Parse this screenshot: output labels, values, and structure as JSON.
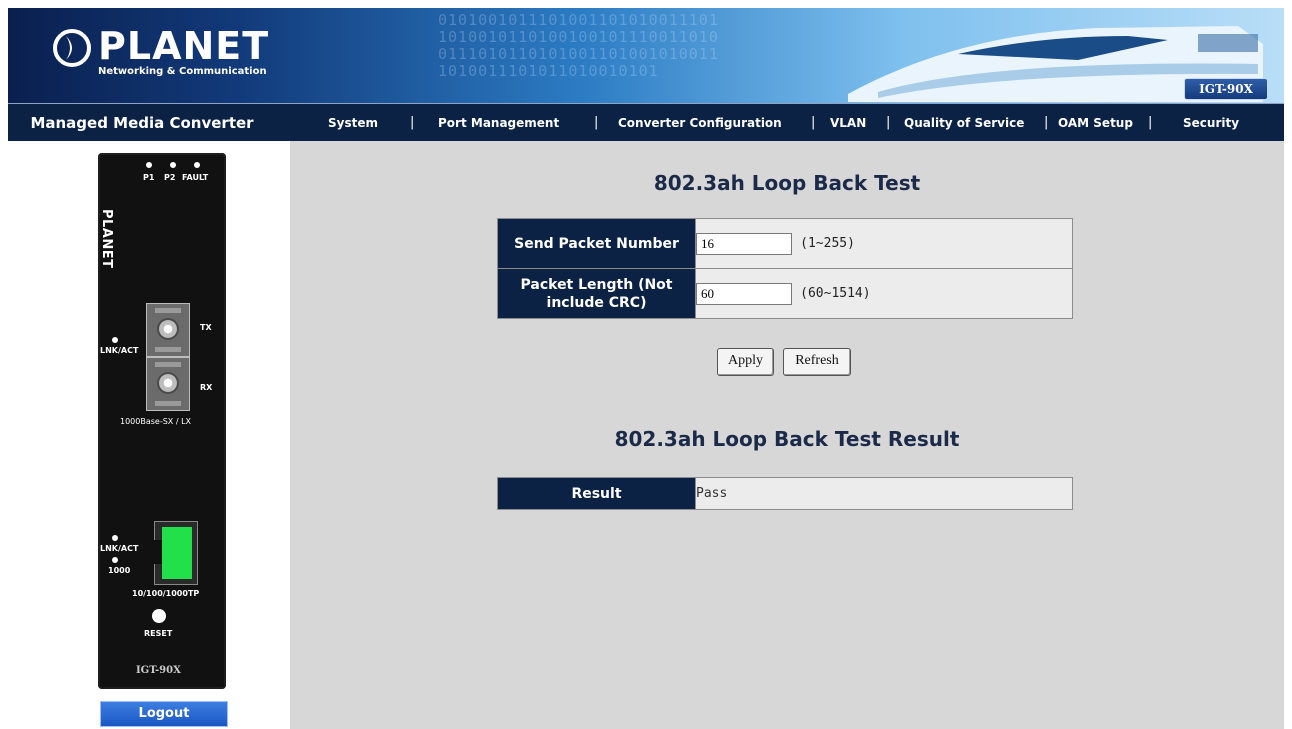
{
  "banner": {
    "brand": "PLANET",
    "tagline": "Networking & Communication",
    "model_badge": "IGT-90X"
  },
  "navbar": {
    "product_name": "Managed Media Converter",
    "items": [
      "System",
      "Port Management",
      "Converter Configuration",
      "VLAN",
      "Quality of Service",
      "OAM Setup",
      "Security"
    ]
  },
  "device": {
    "brand": "PLANET",
    "led_labels": [
      "P1",
      "P2",
      "FAULT"
    ],
    "fiber_link_label": "LNK/ACT",
    "tx_label": "TX",
    "rx_label": "RX",
    "fiber_port_label": "1000Base-SX / LX",
    "tp_link_label": "LNK/ACT",
    "tp_speed_label": "1000",
    "tp_port_label": "10/100/1000TP",
    "reset_label": "RESET",
    "model": "IGT-90X"
  },
  "logout_label": "Logout",
  "loopback_test": {
    "title": "802.3ah Loop Back Test",
    "send_packet_label": "Send Packet Number",
    "send_packet_value": "16",
    "send_packet_range": "(1~255)",
    "packet_length_label": "Packet Length (Not include CRC)",
    "packet_length_value": "60",
    "packet_length_range": "(60~1514)",
    "apply_label": "Apply",
    "refresh_label": "Refresh"
  },
  "loopback_result": {
    "title": "802.3ah Loop Back Test Result",
    "result_label": "Result",
    "result_value": "Pass"
  }
}
